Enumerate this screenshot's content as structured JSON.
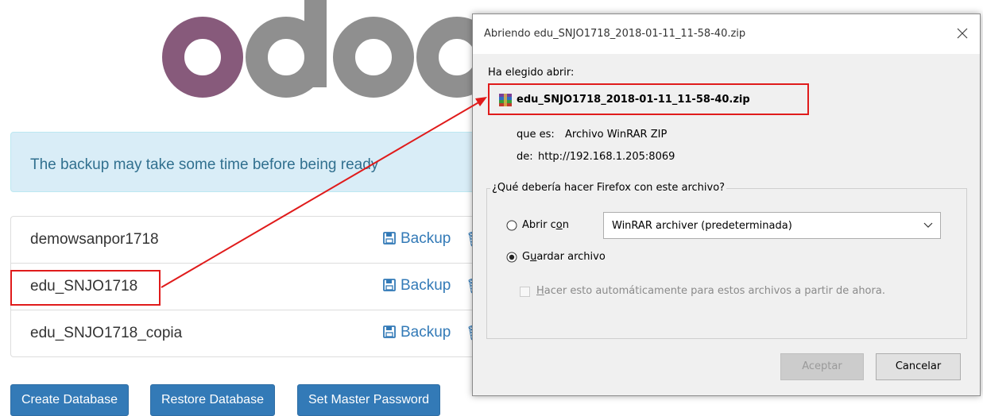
{
  "page": {
    "logo_text": "odoo",
    "alert_text": "The backup may take some time before being ready",
    "databases": [
      {
        "name": "demowsanpor1718",
        "backup_label": "Backup"
      },
      {
        "name": "edu_SNJO1718",
        "backup_label": "Backup"
      },
      {
        "name": "edu_SNJO1718_copia",
        "backup_label": "Backup"
      }
    ],
    "buttons": {
      "create": "Create Database",
      "restore": "Restore Database",
      "master": "Set Master Password"
    }
  },
  "dialog": {
    "title": "Abriendo edu_SNJO1718_2018-01-11_11-58-40.zip",
    "chosen_label": "Ha elegido abrir:",
    "file_name": "edu_SNJO1718_2018-01-11_11-58-40.zip",
    "type_label": "que es:",
    "type_value": "Archivo WinRAR ZIP",
    "from_label": "de:",
    "from_value": "http://192.168.1.205:8069",
    "question": "¿Qué debería hacer Firefox con este archivo?",
    "open_with_label": "Abrir con",
    "open_with_value": "WinRAR archiver (predeterminada)",
    "save_label": "Guardar archivo",
    "auto_label": "Hacer esto automáticamente para estos archivos a partir de ahora.",
    "accept_label": "Aceptar",
    "cancel_label": "Cancelar",
    "selected_option": "save"
  },
  "colors": {
    "odoo_purple": "#875a7b",
    "odoo_grey": "#8f8f8f",
    "link_blue": "#337ab7",
    "annotation_red": "#e01b1b"
  },
  "icons": [
    "save-icon",
    "winrar-icon",
    "close-icon",
    "chevron-down-icon",
    "delete-icon"
  ]
}
